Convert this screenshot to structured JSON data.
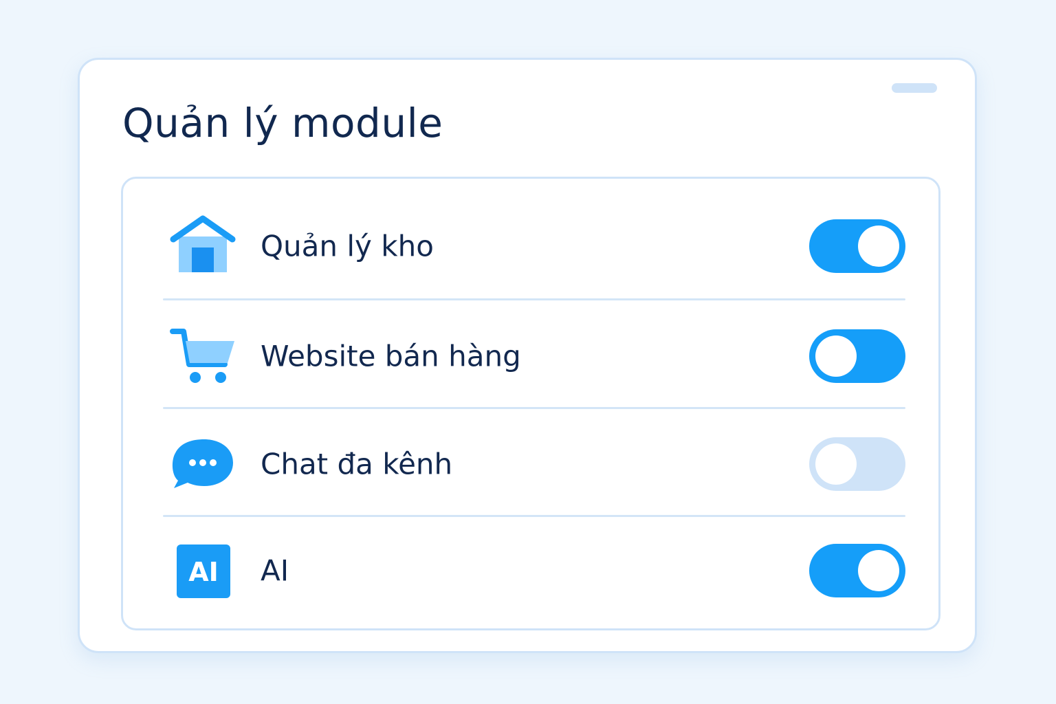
{
  "title": "Quản lý module",
  "colors": {
    "background": "#eef6fd",
    "accent": "#159ef9",
    "text": "#12284f",
    "border": "#cfe3f8",
    "toggle_disabled": "#cfe3f8"
  },
  "modules": [
    {
      "label": "Quản lý kho",
      "icon": "warehouse-icon",
      "toggle": "on"
    },
    {
      "label": "Website bán hàng",
      "icon": "shopping-cart-icon",
      "toggle": "off"
    },
    {
      "label": "Chat đa kênh",
      "icon": "chat-bubble-icon",
      "toggle": "off-disabled"
    },
    {
      "label": "AI",
      "icon": "ai-icon",
      "icon_text": "AI",
      "toggle": "on"
    }
  ]
}
